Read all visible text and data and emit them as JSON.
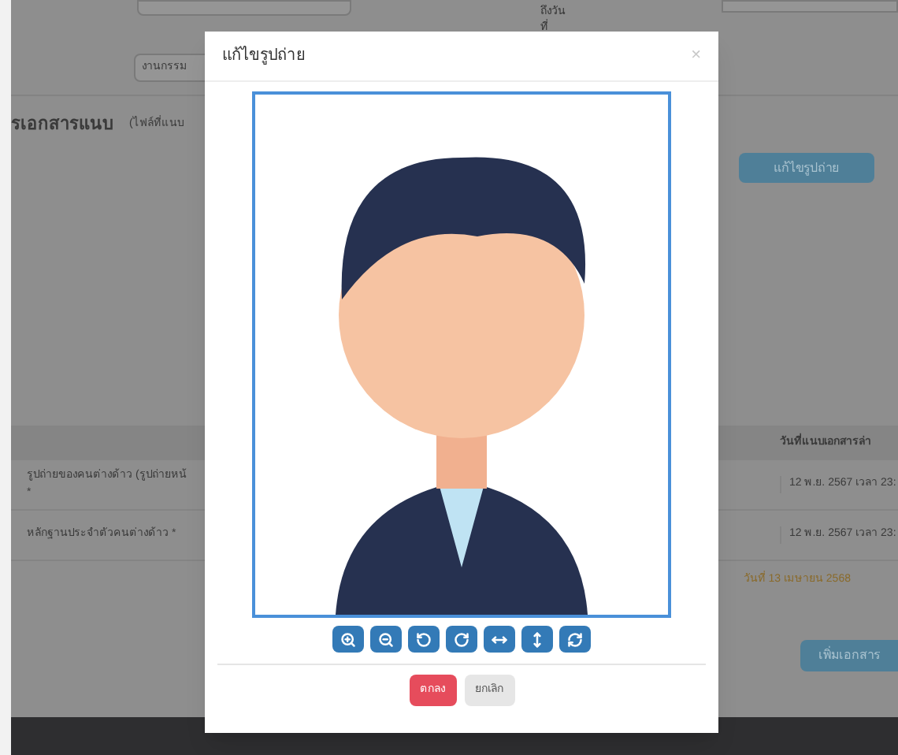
{
  "page": {
    "to_date_label": "ถึงวันที่",
    "agency_value": "งานกรรม",
    "section_title": "รเอกสารแนบ",
    "section_note": "(ไฟล์ที่แนบ",
    "edit_photo_button": "แก้ไขรูปถ่าย",
    "table": {
      "column_2": "วันที่แนบเอกสารล่า",
      "rows": [
        {
          "document": "รูปถ่ายของคนต่างด้าว (รูปถ่ายหน้",
          "mark": "*",
          "date": "12 พ.ย. 2567 เวลา 23:"
        },
        {
          "document": "หลักฐานประจำตัวคนต่างด้าว *",
          "mark": "",
          "date": "12 พ.ย. 2567 เวลา 23:"
        }
      ]
    },
    "note_end": "วันที่ 13 เมษายน 2568",
    "add_button": "เพิ่มเอกสาร"
  },
  "modal": {
    "title": "แก้ไขรูปถ่าย",
    "close": "×",
    "buttons": [
      {
        "label": "ตกลง",
        "kind": "primary"
      },
      {
        "label": "ยกเลิก",
        "kind": "secondary"
      }
    ]
  }
}
